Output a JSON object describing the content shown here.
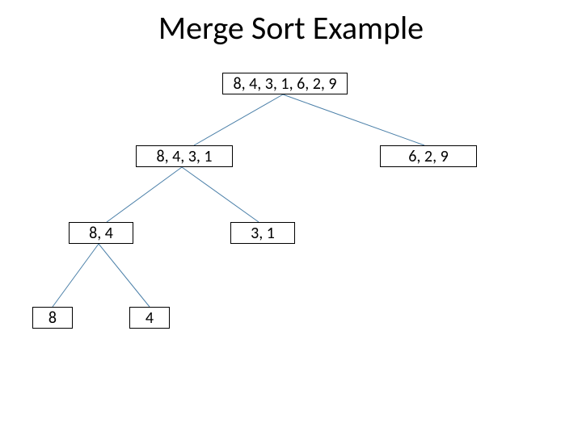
{
  "title": "Merge Sort Example",
  "nodes": {
    "root": "8, 4, 3, 1, 6, 2, 9",
    "left1": "8, 4, 3, 1",
    "right1": "6, 2, 9",
    "ll2": "8, 4",
    "lr2": "3, 1",
    "lll3": "8",
    "llr3": "4"
  }
}
